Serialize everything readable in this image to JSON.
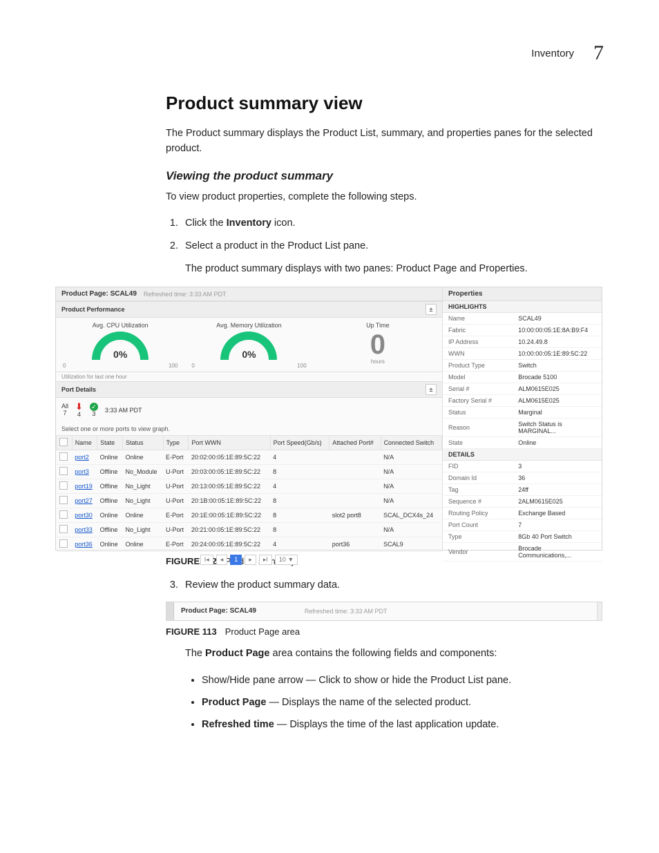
{
  "header": {
    "section": "Inventory",
    "chapter": "7"
  },
  "h1": "Product summary view",
  "intro": "The Product summary displays the Product List, summary, and properties panes for the selected product.",
  "sub": "Viewing the product summary",
  "sub_intro": "To view product properties, complete the following steps.",
  "steps": {
    "s1_a": "Click the ",
    "s1_b": "Inventory",
    "s1_c": " icon.",
    "s2": "Select a product in the Product List pane.",
    "s2_sub": "The product summary displays with two panes: Product Page and Properties.",
    "s3": "Review the product summary data."
  },
  "fig112": {
    "label": "FIGURE 112",
    "caption": "Product summary"
  },
  "fig113": {
    "label": "FIGURE 113",
    "caption": "Product Page area"
  },
  "after113_a": "The ",
  "after113_b": "Product Page",
  "after113_c": " area contains the following fields and components:",
  "bullets": {
    "b1": "Show/Hide pane arrow — Click to show or hide the Product List pane.",
    "b2_a": "Product Page",
    "b2_b": " — Displays the name of the selected product.",
    "b3_a": "Refreshed time",
    "b3_b": " — Displays the time of the last application update."
  },
  "shot": {
    "product_page_label": "Product Page: SCAL49",
    "refreshed": "Refreshed time: 3:33 AM PDT",
    "perf_head": "Product Performance",
    "cpu_label": "Avg. CPU Utilization",
    "cpu_val": "0%",
    "mem_label": "Avg. Memory Utilization",
    "mem_val": "0%",
    "uptime_label": "Up Time",
    "uptime_val": "0",
    "uptime_unit": "hours",
    "tick_lo": "0",
    "tick_hi": "100",
    "perf_note": "Utilization for last one hour",
    "port_head": "Port Details",
    "filter_all_label": "All",
    "filter_all_n": "7",
    "filter_down_n": "4",
    "filter_up_n": "3",
    "filter_time": "3:33 AM PDT",
    "port_note": "Select one or more ports to view graph.",
    "cols": {
      "c0": "",
      "c1": "Name",
      "c2": "State",
      "c3": "Status",
      "c4": "Type",
      "c5": "Port WWN",
      "c6": "Port Speed(Gb/s)",
      "c7": "Attached Port#",
      "c8": "Connected Switch"
    },
    "rows": [
      {
        "name": "port2",
        "state": "Online",
        "status": "Online",
        "type": "E-Port",
        "wwn": "20:02:00:05:1E:89:5C:22",
        "speed": "4",
        "att": "",
        "sw": "N/A"
      },
      {
        "name": "port3",
        "state": "Offline",
        "status": "No_Module",
        "type": "U-Port",
        "wwn": "20:03:00:05:1E:89:5C:22",
        "speed": "8",
        "att": "",
        "sw": "N/A"
      },
      {
        "name": "port19",
        "state": "Offline",
        "status": "No_Light",
        "type": "U-Port",
        "wwn": "20:13:00:05:1E:89:5C:22",
        "speed": "4",
        "att": "",
        "sw": "N/A"
      },
      {
        "name": "port27",
        "state": "Offline",
        "status": "No_Light",
        "type": "U-Port",
        "wwn": "20:1B:00:05:1E:89:5C:22",
        "speed": "8",
        "att": "",
        "sw": "N/A"
      },
      {
        "name": "port30",
        "state": "Online",
        "status": "Online",
        "type": "E-Port",
        "wwn": "20:1E:00:05:1E:89:5C:22",
        "speed": "8",
        "att": "slot2 port8",
        "sw": "SCAL_DCX4s_24"
      },
      {
        "name": "port33",
        "state": "Offline",
        "status": "No_Light",
        "type": "U-Port",
        "wwn": "20:21:00:05:1E:89:5C:22",
        "speed": "8",
        "att": "",
        "sw": "N/A"
      },
      {
        "name": "port36",
        "state": "Online",
        "status": "Online",
        "type": "E-Port",
        "wwn": "20:24:00:05:1E:89:5C:22",
        "speed": "4",
        "att": "port36",
        "sw": "SCAL9"
      }
    ],
    "pager": {
      "first": "I◂",
      "prev": "◂",
      "active": "1",
      "next": "▸",
      "last": "▸I",
      "size": "10 ▼"
    },
    "props_head": "Properties",
    "highlights": "HIGHLIGHTS",
    "details": "DETAILS",
    "prop_rows_hl": [
      {
        "k": "Name",
        "v": "SCAL49"
      },
      {
        "k": "Fabric",
        "v": "10:00:00:05:1E:8A:B9:F4"
      },
      {
        "k": "IP Address",
        "v": "10.24.49.8"
      },
      {
        "k": "WWN",
        "v": "10:00:00:05:1E:89:5C:22"
      },
      {
        "k": "Product Type",
        "v": "Switch"
      },
      {
        "k": "Model",
        "v": "Brocade 5100"
      },
      {
        "k": "Serial #",
        "v": "ALM0615E025"
      },
      {
        "k": "Factory Serial #",
        "v": "ALM0615E025"
      },
      {
        "k": "Status",
        "v": "Marginal"
      },
      {
        "k": "Reason",
        "v": "Switch Status is MARGINAL..."
      },
      {
        "k": "State",
        "v": "Online"
      }
    ],
    "prop_rows_det": [
      {
        "k": "FID",
        "v": "3"
      },
      {
        "k": "Domain Id",
        "v": "36"
      },
      {
        "k": "Tag",
        "v": "24ff"
      },
      {
        "k": "Sequence #",
        "v": "2ALM0615E025"
      },
      {
        "k": "Routing Policy",
        "v": "Exchange Based"
      },
      {
        "k": "Port Count",
        "v": "7"
      },
      {
        "k": "Type",
        "v": "8Gb 40 Port Switch"
      },
      {
        "k": "Vendor",
        "v": "Brocade Communications,..."
      }
    ]
  }
}
